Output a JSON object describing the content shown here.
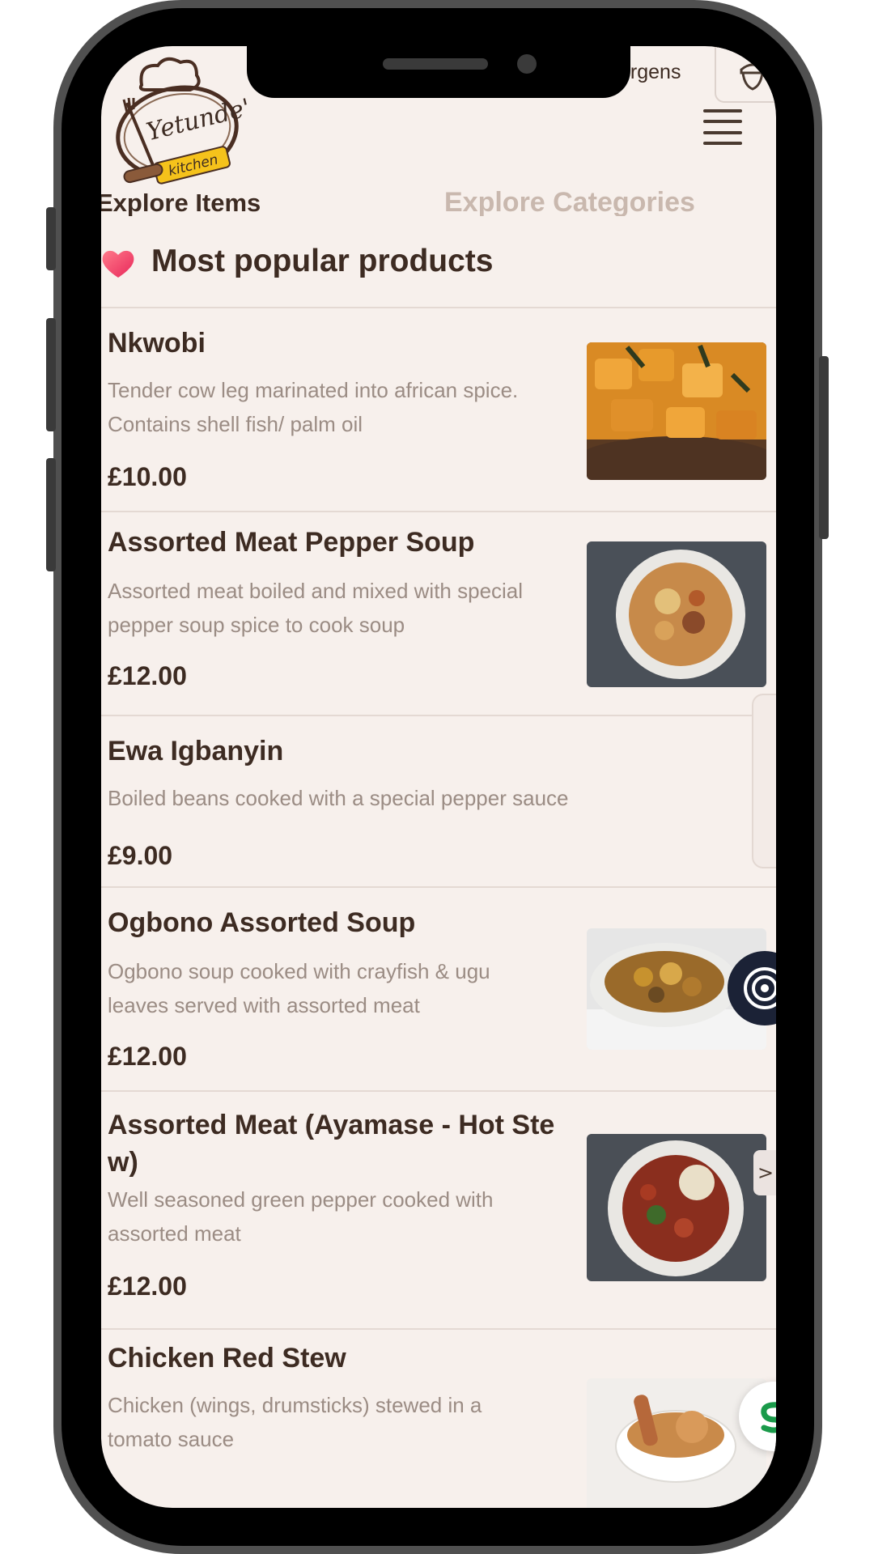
{
  "header": {
    "allergens_label": "Allergens",
    "allergens_visible": "ergens",
    "logo_text": "Yetunde's",
    "logo_subtext": "kitchen",
    "menu_icon": "hamburger-menu-icon"
  },
  "tabs": {
    "items_label": "Explore Items",
    "categories_label": "Explore Categories",
    "active": "Explore Items"
  },
  "section": {
    "title": "Most popular products",
    "icon": "heart-icon"
  },
  "products": [
    {
      "name": "Nkwobi",
      "description": "Tender cow leg marinated into african spice. Contains shell fish/ palm oil",
      "price": "£10.00"
    },
    {
      "name": "Assorted Meat Pepper Soup",
      "description": "Assorted meat boiled and mixed with special pepper soup spice to cook soup",
      "price": "£12.00"
    },
    {
      "name": "Ewa Igbanyin",
      "description": "Boiled beans cooked with a special pepper sauce",
      "price": "£9.00"
    },
    {
      "name": "Ogbono Assorted Soup",
      "description": "Ogbono soup cooked with crayfish & ugu leaves served with assorted meat",
      "price": "£12.00"
    },
    {
      "name": "Assorted Meat (Ayamase - Hot Ste w)",
      "description": "Well seasoned green pepper cooked with assorted meat",
      "price": "£12.00"
    },
    {
      "name": "Chicken Red Stew",
      "description": "Chicken (wings, drumsticks) stewed in a tomato sauce",
      "price": ""
    }
  ],
  "floating": {
    "arrow_label": ">"
  },
  "colors": {
    "background": "#f7f0ec",
    "text_dark": "#3d2b22",
    "text_muted": "#9b8c84",
    "tab_inactive": "#c9b8ae",
    "accent_yellow": "#f5c21b",
    "heart": "#ef3f6b"
  }
}
